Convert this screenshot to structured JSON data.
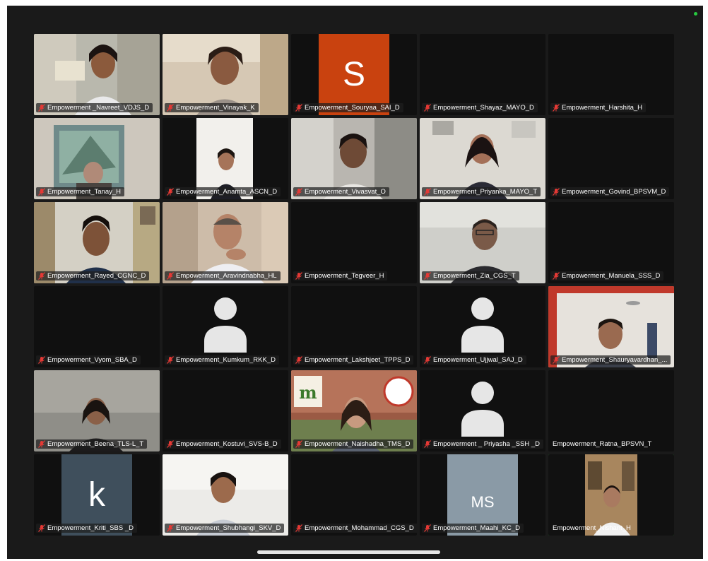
{
  "meeting": {
    "participants": [
      {
        "name": "Empowerment _Navreet_VDJS_D",
        "muted": true,
        "video": "scene"
      },
      {
        "name": "Empowerment_Vinayak_K",
        "muted": true,
        "video": "scene"
      },
      {
        "name": "Empowerment_Souryaa_SAI_D",
        "muted": true,
        "video": "initial",
        "initial": "S",
        "tile_color": "#c9420f"
      },
      {
        "name": "Empowerment_Shayaz_MAYO_D",
        "muted": true,
        "video": "off"
      },
      {
        "name": "Empowerment_Harshita_H",
        "muted": true,
        "video": "off"
      },
      {
        "name": "Empowerment_Tanay_H",
        "muted": true,
        "video": "scene"
      },
      {
        "name": "Empowerment_Anamta_ASCN_D",
        "muted": true,
        "video": "scene"
      },
      {
        "name": "Empowerment_Vivasvat_O",
        "muted": true,
        "video": "scene"
      },
      {
        "name": "Empowerment_Priyanka_MAYO_T",
        "muted": true,
        "video": "scene"
      },
      {
        "name": "Empowerment_Govind_BPSVM_D",
        "muted": true,
        "video": "off"
      },
      {
        "name": "Empowerment_Rayed_CGNC_D",
        "muted": true,
        "video": "scene"
      },
      {
        "name": "Empowerment_Aravindnabha_HL",
        "muted": true,
        "video": "scene"
      },
      {
        "name": "Empowerment_Tegveer_H",
        "muted": true,
        "video": "off"
      },
      {
        "name": "Empowerment_Zia_CGS_T",
        "muted": true,
        "video": "scene"
      },
      {
        "name": "Empowerment_Manuela_SSS_D",
        "muted": true,
        "video": "off"
      },
      {
        "name": "Empowerment_Vyom_SBA_D",
        "muted": true,
        "video": "off"
      },
      {
        "name": "Empowerment_Kumkum_RKK_D",
        "muted": true,
        "video": "avatar"
      },
      {
        "name": "Empowerment_Lakshjeet_TPPS_D",
        "muted": true,
        "video": "off"
      },
      {
        "name": "Empowerment_Ujjwal_SAJ_D",
        "muted": true,
        "video": "avatar"
      },
      {
        "name": "Empowerment_Shauryavardhan_...",
        "muted": true,
        "video": "scene"
      },
      {
        "name": "Empowerment_Beena_TLS-L_T",
        "muted": true,
        "video": "scene"
      },
      {
        "name": "Empowerment_Kostuvi_SVS-B_D",
        "muted": true,
        "video": "off"
      },
      {
        "name": "Empowerment_Naishadha_TMS_D",
        "muted": true,
        "video": "scene"
      },
      {
        "name": "Empowerment _ Priyasha _SSH _D",
        "muted": true,
        "video": "avatar"
      },
      {
        "name": "Empowerment_Ratna_BPSVN_T",
        "muted": false,
        "video": "off"
      },
      {
        "name": "Empowerment_Kriti_SBS _D",
        "muted": true,
        "video": "initial",
        "initial": "k",
        "tile_color": "#3f4f5c"
      },
      {
        "name": "Empowerment_Shubhangi_SKV_D",
        "muted": true,
        "video": "scene"
      },
      {
        "name": "Empowerment_Mohammad_CGS_D",
        "muted": true,
        "video": "off"
      },
      {
        "name": "Empowerment_Maahi_KC_D",
        "muted": true,
        "video": "initial",
        "initial": "MS",
        "tile_color": "#8a9aa6"
      },
      {
        "name": "Empowerment_Nishant_H",
        "muted": false,
        "video": "scene",
        "speaking": true
      }
    ],
    "colors": {
      "speaking_border": "#2ecc40",
      "muted_icon": "#e53935",
      "status_dot": "#27c93f"
    },
    "icons": {
      "muted": "mic-off-icon",
      "avatar": "person-icon"
    }
  }
}
